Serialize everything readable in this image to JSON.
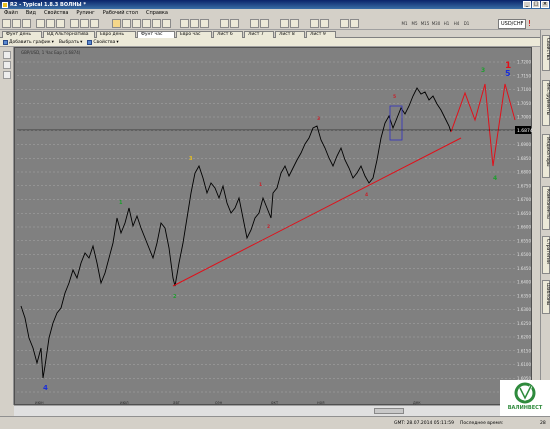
{
  "window": {
    "title": "R2 - Typical 1.8.3 ВОЛНЫ *",
    "min": "_",
    "max": "□",
    "close": "×"
  },
  "menu": [
    "Файл",
    "Вид",
    "Свойства",
    "Рупинг",
    "Рабочий стол",
    "Справка"
  ],
  "toolbar": {
    "timeframes": [
      "M1",
      "M5",
      "M15",
      "M30",
      "H1",
      "H4",
      "D1"
    ],
    "symbol": "USD/CHF"
  },
  "tabs": [
    "Фунт день",
    "ВД Альтернатива",
    "Евро день",
    "Фунт час",
    "Евро час",
    "Лист 6",
    "Лист 7",
    "Лист 8",
    "Лист 9"
  ],
  "active_tab_index": 3,
  "subtoolbar": {
    "add_chart": "Добавить график",
    "select": "Выбрать",
    "properties": "Свойства"
  },
  "chart": {
    "legend": "GBP/USD, 1 Час Бар (1.6874)",
    "price_labels": [
      "1.7200",
      "1.7150",
      "1.7100",
      "1.7050",
      "1.7000",
      "1.6950",
      "1.6900",
      "1.6850",
      "1.6800",
      "1.6750",
      "1.6700",
      "1.6650",
      "1.6600",
      "1.6550",
      "1.6500",
      "1.6450",
      "1.6400",
      "1.6350",
      "1.6300",
      "1.6250",
      "1.6200",
      "1.6150",
      "1.6100",
      "1.6050",
      "1.6000"
    ],
    "current_price": "1.6874",
    "x_labels": [
      "июн",
      "июл",
      "2014",
      "авг",
      "сен",
      "окт",
      "ноя",
      "дек"
    ],
    "wave_labels": [
      {
        "text": "4",
        "color": "#1a2fd8"
      },
      {
        "text": "1",
        "color": "#1e9e2e"
      },
      {
        "text": "2",
        "color": "#1e9e2e"
      },
      {
        "text": "3",
        "color": "#e8c020"
      },
      {
        "text": "1",
        "color": "#c8202a"
      },
      {
        "text": "2",
        "color": "#c8202a"
      },
      {
        "text": "3",
        "color": "#c8202a"
      },
      {
        "text": "4",
        "color": "#c8202a"
      },
      {
        "text": "5",
        "color": "#c8202a"
      },
      {
        "text": "3",
        "color": "#1e9e2e"
      },
      {
        "text": "4",
        "color": "#1e9e2e"
      },
      {
        "text": "1",
        "color": "#e0101a"
      },
      {
        "text": "5",
        "color": "#1a2fd8"
      }
    ]
  },
  "right_tabs": [
    "Свойства",
    "Инструменты",
    "Индикаторы",
    "Компоненты",
    "Стратегии",
    "Шаблоны"
  ],
  "status": {
    "gmt": "GMT: 28.07.2014 05:11:59",
    "last_time_label": "Последнее время:",
    "last_time": "28"
  },
  "logo": {
    "name": "ВАЛИНВЕСТ",
    "color": "#2e8a3c"
  }
}
